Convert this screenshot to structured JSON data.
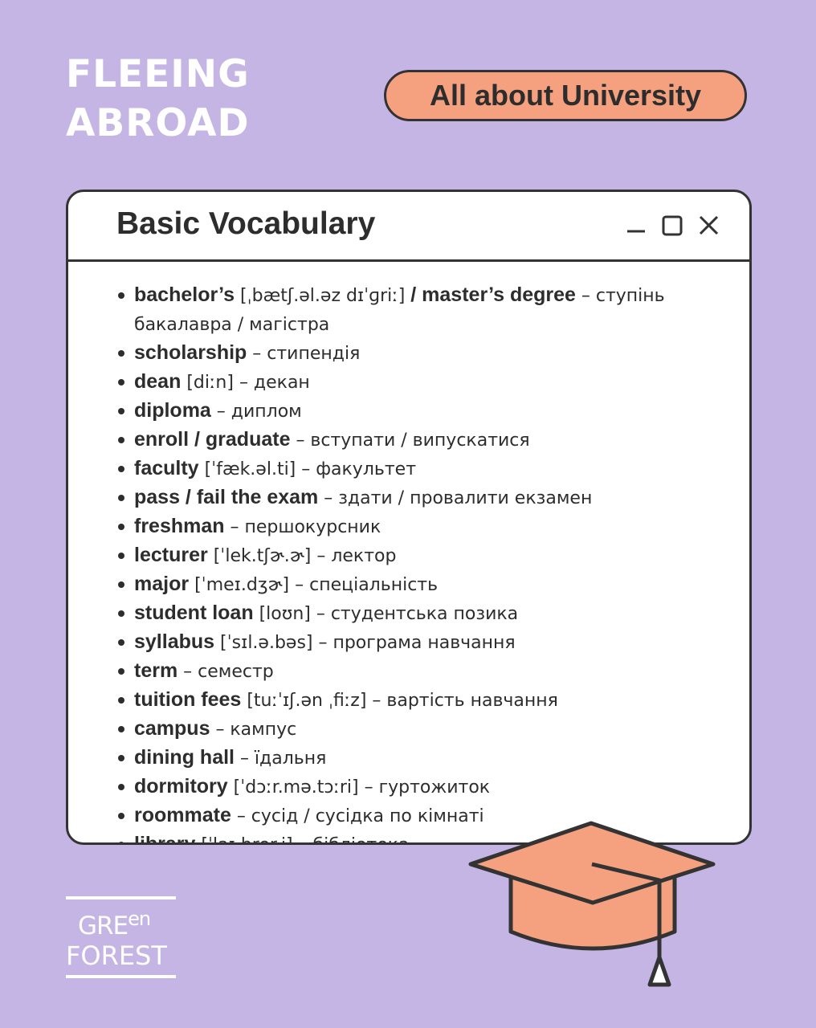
{
  "brand": {
    "title_line1": "FLEEING",
    "title_line2": "ABROAD"
  },
  "topic": {
    "label": "All about University"
  },
  "window": {
    "title": "Basic Vocabulary",
    "controls": [
      "minimize-icon",
      "maximize-icon",
      "close-icon"
    ]
  },
  "vocabulary": [
    {
      "term": "bachelor’s",
      "ipa": " [ˌbætʃ.əl.əz dɪˈɡriː] ",
      "term2": "/ master’s degree",
      "translation": "ступінь бакалавра / магістра"
    },
    {
      "term": "scholarship",
      "ipa": "",
      "term2": "",
      "translation": "стипендія"
    },
    {
      "term": "dean",
      "ipa": " [diːn] ",
      "term2": "",
      "translation": "декан"
    },
    {
      "term": "diploma",
      "ipa": "",
      "term2": "",
      "translation": "диплом"
    },
    {
      "term": "enroll / graduate",
      "ipa": "",
      "term2": "",
      "translation": "вступати / випускатися"
    },
    {
      "term": "faculty",
      "ipa": " [ˈfæk.əl.ti] ",
      "term2": "",
      "translation": "факультет"
    },
    {
      "term": "pass / fail the exam",
      "ipa": "",
      "term2": "",
      "translation": "здати / провалити екзамен"
    },
    {
      "term": "freshman",
      "ipa": "",
      "term2": "",
      "translation": "першокурсник"
    },
    {
      "term": "lecturer",
      "ipa": " [ˈlek.tʃɚ.ɚ] ",
      "term2": "",
      "translation": "лектор"
    },
    {
      "term": "major",
      "ipa": " [ˈmeɪ.dʒɚ] ",
      "term2": "",
      "translation": "спеціальність"
    },
    {
      "term": "student loan",
      "ipa": " [loʊn] ",
      "term2": "",
      "translation": "студентська позика"
    },
    {
      "term": "syllabus",
      "ipa": " [ˈsɪl.ə.bəs] ",
      "term2": "",
      "translation": "програма навчання"
    },
    {
      "term": "term",
      "ipa": "",
      "term2": "",
      "translation": "семестр"
    },
    {
      "term": "tuition fees",
      "ipa": " [tuːˈɪʃ.ən ˌfiːz] ",
      "term2": "",
      "translation": "вартість навчання"
    },
    {
      "term": "campus",
      "ipa": "",
      "term2": "",
      "translation": "кампус"
    },
    {
      "term": "dining hall",
      "ipa": "",
      "term2": "",
      "translation": "їдальня"
    },
    {
      "term": "dormitory",
      "ipa": " [ˈdɔːr.mə.tɔːri] ",
      "term2": "",
      "translation": "гуртожиток"
    },
    {
      "term": "roommate",
      "ipa": "",
      "term2": "",
      "translation": "сусід / сусідка по кімнаті"
    },
    {
      "term": "library",
      "ipa": " [ˈlaɪ.brer.i] ",
      "term2": "",
      "translation": "бібліотека"
    }
  ],
  "separator": "–",
  "logo": {
    "line1": "GRE",
    "line1_sup": "en",
    "line2": "FOREST"
  },
  "illustration": {
    "icon": "graduation-cap-icon"
  },
  "colors": {
    "background": "#c4b5e4",
    "accent": "#f5a07e",
    "outline": "#333333",
    "text": "#2d2d2d",
    "white": "#ffffff"
  }
}
